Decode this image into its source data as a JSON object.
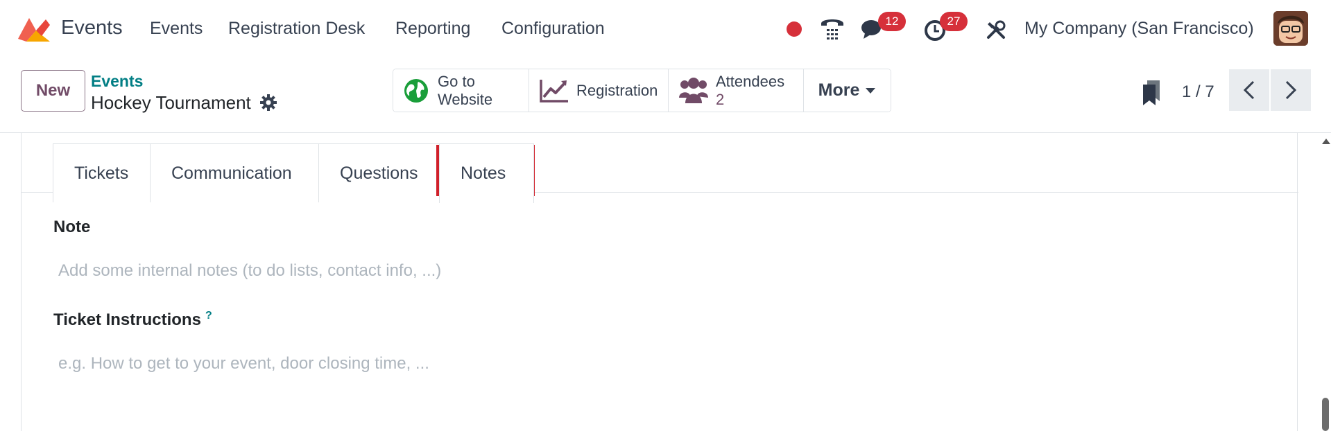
{
  "navbar": {
    "app_name": "Events",
    "menu": [
      "Events",
      "Registration Desk",
      "Reporting",
      "Configuration"
    ],
    "messages_count": "12",
    "activities_count": "27",
    "company": "My Company (San Francisco)"
  },
  "control": {
    "new_label": "New",
    "breadcrumb_parent": "Events",
    "record_title": "Hockey Tournament",
    "stat_buttons": {
      "website_line1": "Go to",
      "website_line2": "Website",
      "registration": "Registration",
      "attendees_label": "Attendees",
      "attendees_count": "2",
      "more": "More"
    },
    "pager": "1 / 7"
  },
  "tabs": [
    "Tickets",
    "Communication",
    "Questions",
    "Notes"
  ],
  "active_tab": "Notes",
  "form": {
    "note_label": "Note",
    "note_placeholder": "Add some internal notes (to do lists, contact info, ...)",
    "ticket_label": "Ticket Instructions",
    "ticket_help": "?",
    "ticket_placeholder": "e.g. How to get to your event, door closing time, ..."
  },
  "colors": {
    "brand": "#714b67",
    "link": "#017e84",
    "badge": "#d6303a",
    "highlight": "#d0202a"
  }
}
